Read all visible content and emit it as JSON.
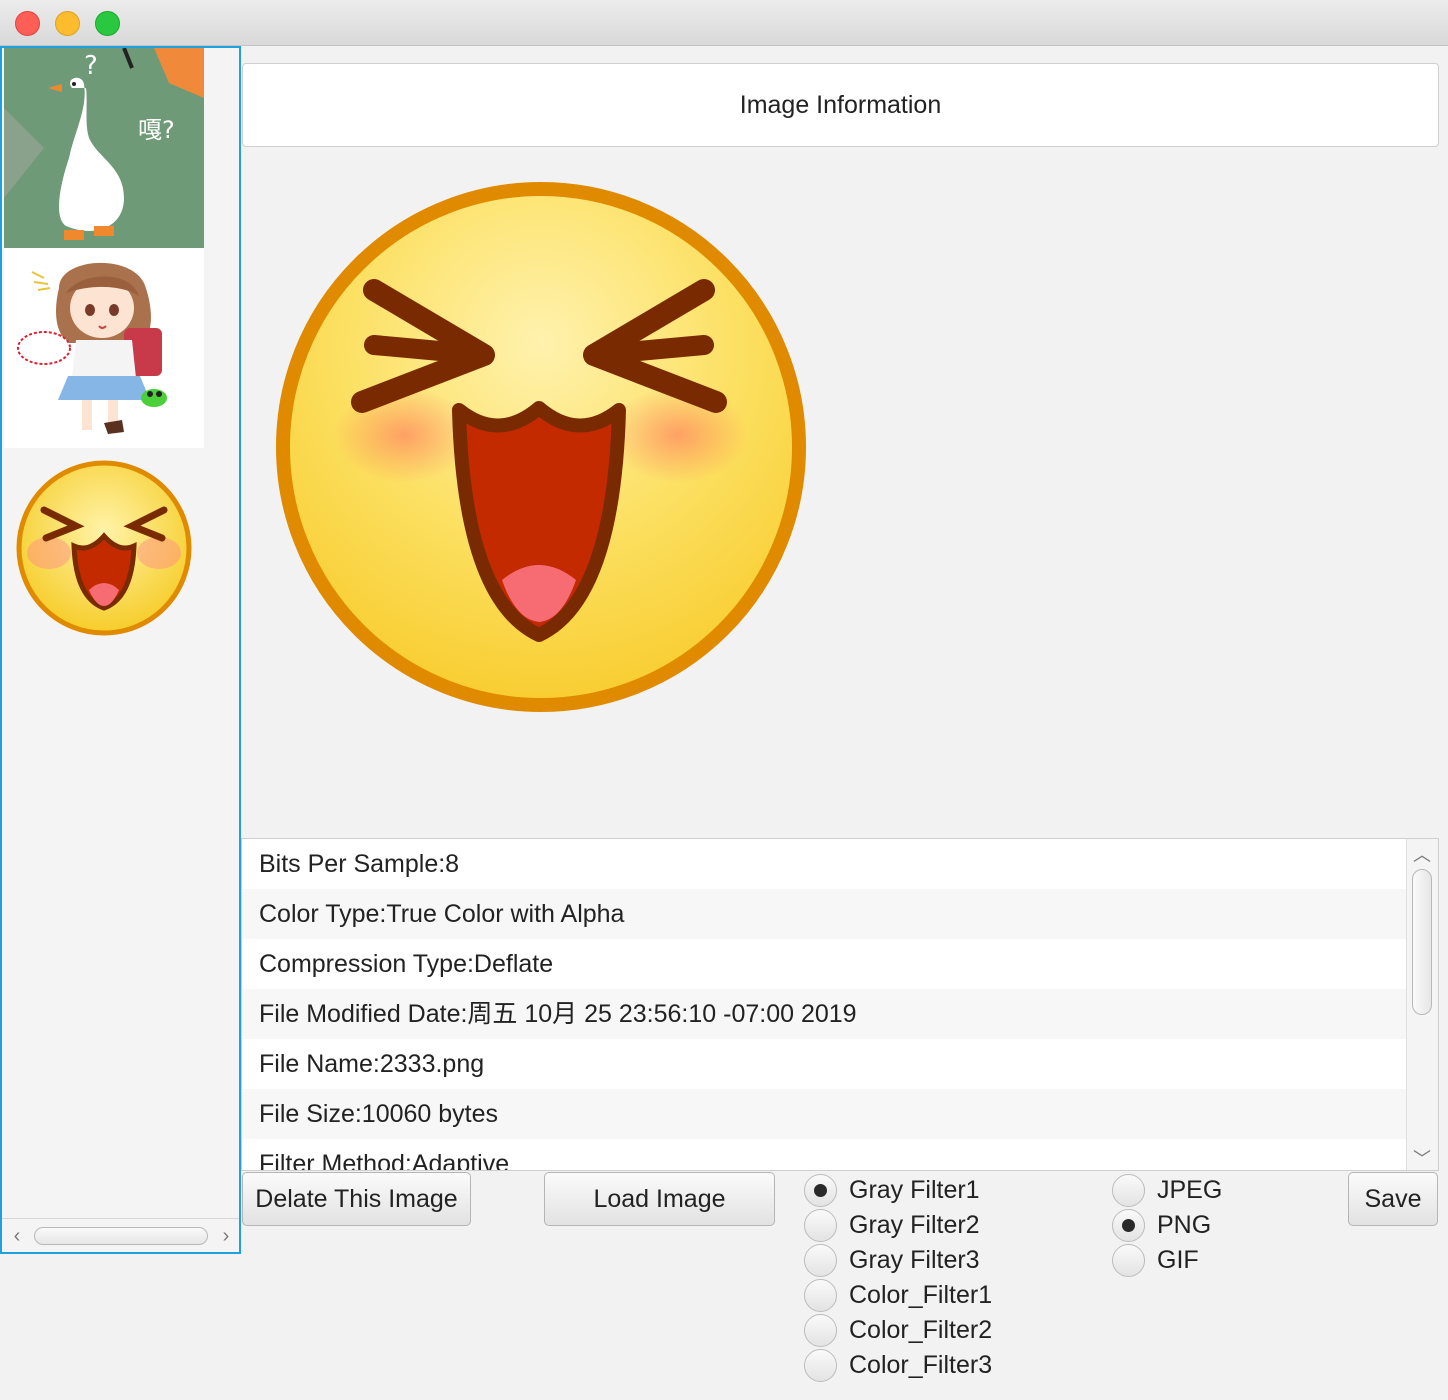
{
  "window": {
    "controls": [
      "close",
      "minimize",
      "maximize"
    ]
  },
  "thumbnails": [
    {
      "name": "goose-thumb",
      "caption_text": "嘎?",
      "mark": "?"
    },
    {
      "name": "anime-girl-thumb"
    },
    {
      "name": "laughing-emoji-thumb"
    }
  ],
  "header": {
    "title": "Image Information"
  },
  "properties": [
    "Bits Per Sample:8",
    "Color Type:True Color with Alpha",
    "Compression Type:Deflate",
    "File Modified Date:周五 10月 25 23:56:10 -07:00 2019",
    "File Name:2333.png",
    "File Size:10060 bytes",
    "Filter Method:Adaptive"
  ],
  "buttons": {
    "delete": "Delate This Image",
    "load": "Load Image",
    "save": "Save"
  },
  "filters": {
    "selected": "Gray Filter1",
    "options": [
      "Gray Filter1",
      "Gray Filter2",
      "Gray Filter3",
      "Color_Filter1",
      "Color_Filter2",
      "Color_Filter3"
    ]
  },
  "formats": {
    "selected": "PNG",
    "options": [
      "JPEG",
      "PNG",
      "GIF"
    ]
  },
  "colors": {
    "list_border": "#1fa0e0",
    "emoji_face": "#fbe15a",
    "emoji_outline": "#e08a00",
    "emoji_features": "#7a2a00"
  }
}
